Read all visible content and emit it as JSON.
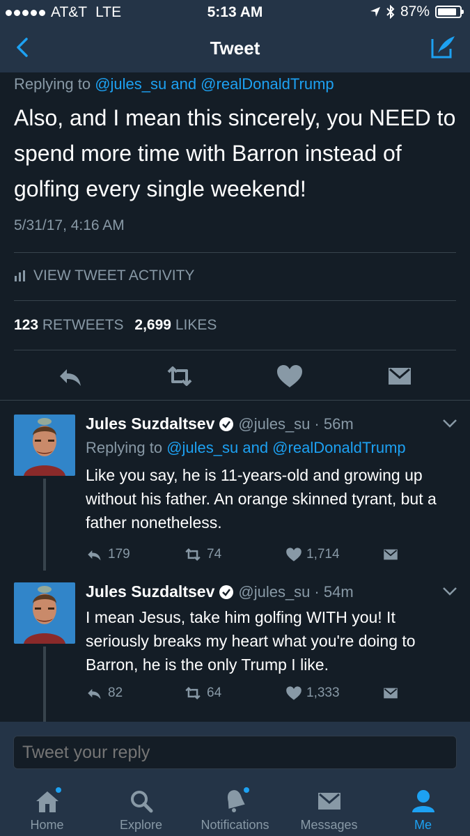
{
  "status": {
    "carrier": "AT&T",
    "network": "LTE",
    "time": "5:13 AM",
    "battery": "87%",
    "battery_level": 0.87
  },
  "nav": {
    "title": "Tweet"
  },
  "tweet": {
    "replying_prefix": "Replying to",
    "replying_handles": "@jules_su and @realDonaldTrump",
    "text": "Also, and I mean this sincerely, you NEED to spend more time with Barron instead of golfing every single weekend!",
    "timestamp": "5/31/17, 4:16 AM",
    "activity_label": "VIEW TWEET ACTIVITY",
    "retweets_count": "123",
    "retweets_label": "RETWEETS",
    "likes_count": "2,699",
    "likes_label": "LIKES"
  },
  "replies": [
    {
      "name": "Jules Suzdaltsev",
      "handle": "@jules_su",
      "time": "· 56m",
      "replying_prefix": "Replying to",
      "replying_handles": "@jules_su and @realDonaldTrump",
      "text": "Like you say, he is 11-years-old and growing up without his father. An orange skinned tyrant, but a father nonetheless.",
      "replies": "179",
      "retweets": "74",
      "likes": "1,714"
    },
    {
      "name": "Jules Suzdaltsev",
      "handle": "@jules_su",
      "time": "· 54m",
      "text": "I mean Jesus, take him golfing WITH you! It seriously breaks my heart what you're doing to Barron, he is the only Trump I like.",
      "replies": "82",
      "retweets": "64",
      "likes": "1,333"
    }
  ],
  "reply_box": {
    "placeholder": "Tweet your reply"
  },
  "tabs": [
    {
      "label": "Home"
    },
    {
      "label": "Explore"
    },
    {
      "label": "Notifications"
    },
    {
      "label": "Messages"
    },
    {
      "label": "Me"
    }
  ],
  "colors": {
    "background": "#141d26",
    "bar": "#243447",
    "accent": "#1da1f2",
    "secondary_text": "#8899a6"
  }
}
